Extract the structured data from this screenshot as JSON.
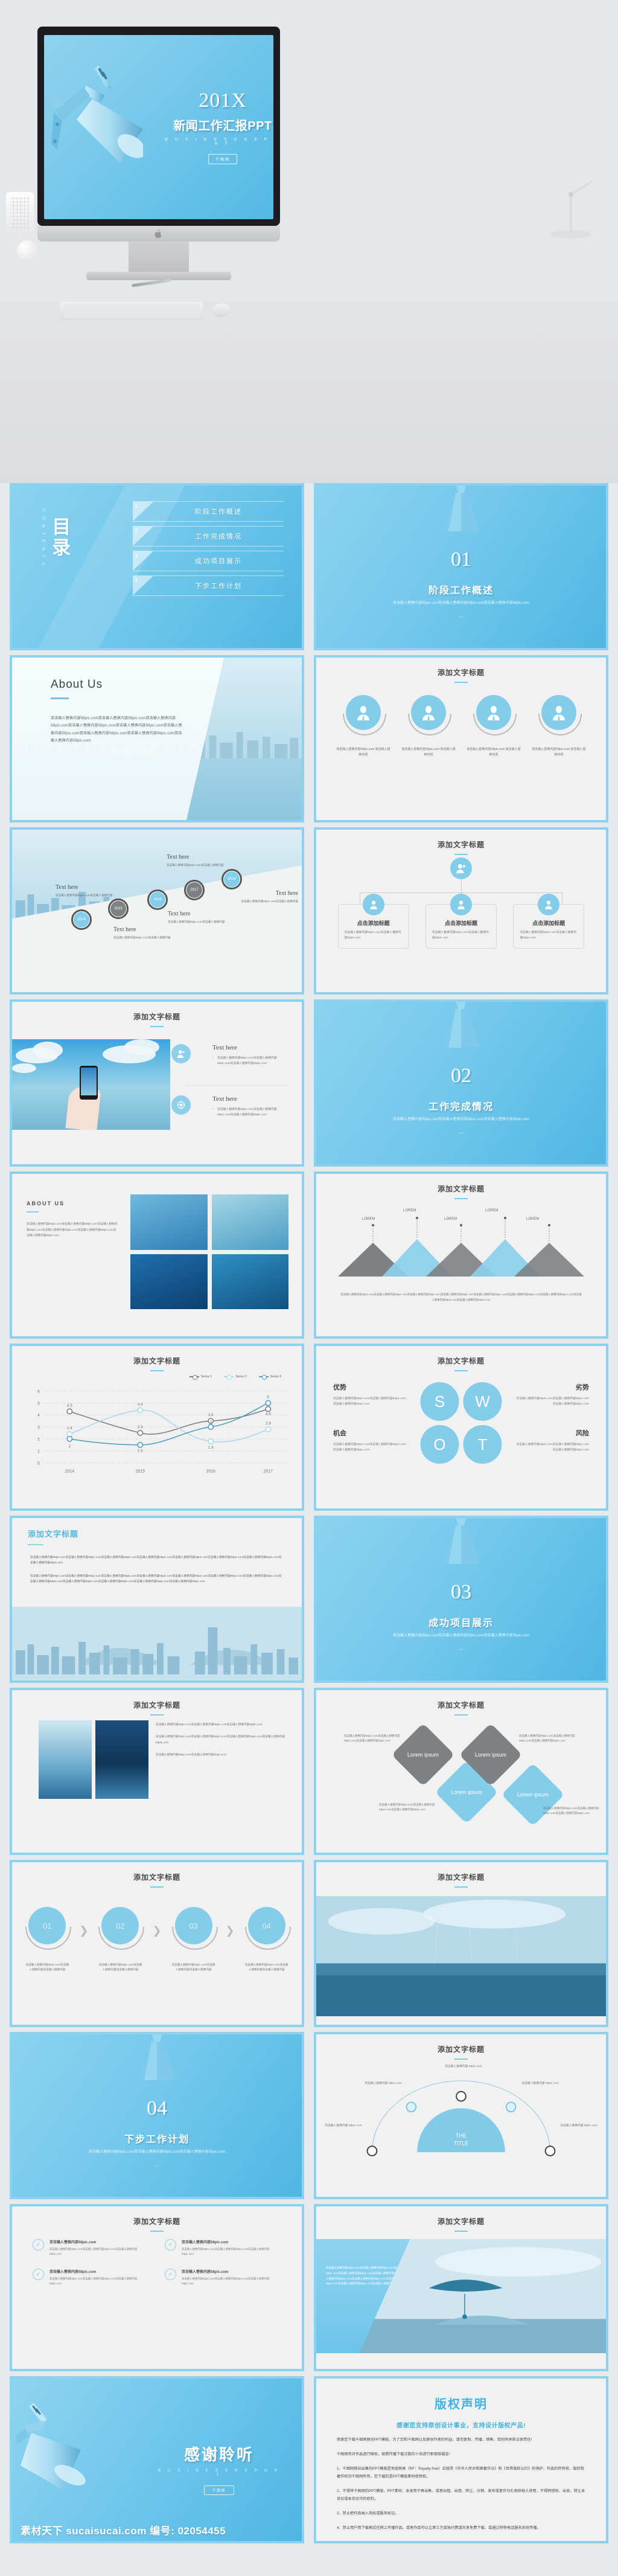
{
  "cover": {
    "year": "201X",
    "title": "新闻工作汇报PPT",
    "subtitle": "B U S I N E S S   R E P O R T",
    "badge": "千图网"
  },
  "toc": {
    "heading_cn": "目录",
    "heading_en": "C O N T E N T S",
    "items": [
      {
        "num": "1",
        "label": "阶段工作概述"
      },
      {
        "num": "2",
        "label": "工作完成情况"
      },
      {
        "num": "3",
        "label": "成功项目展示"
      },
      {
        "num": "4",
        "label": "下步工作计划"
      }
    ]
  },
  "sections": [
    {
      "num": "01",
      "cn": "阶段工作概述",
      "desc": "双击输入替换内容58pic.com双击输入替换内容58pic.com双击输入替换内容58pic.com",
      "dash": "—"
    },
    {
      "num": "02",
      "cn": "工作完成情况",
      "desc": "双击输入替换内容58pic.com双击输入替换内容58pic.com双击输入替换内容58pic.com",
      "dash": "—"
    },
    {
      "num": "03",
      "cn": "成功项目展示",
      "desc": "双击输入替换内容58pic.com双击输入替换内容58pic.com双击输入替换内容58pic.com",
      "dash": "—"
    },
    {
      "num": "04",
      "cn": "下步工作计划",
      "desc": "双击输入替换内容58pic.com双击输入替换内容58pic.com双击输入替换内容58pic.com",
      "dash": "—"
    }
  ],
  "common": {
    "slide_title": "添加文字标题",
    "placeholder_para": "双击输入替换内容58pic.com双击输入替换内容58pic.com双击输入替换内容58pic.com双击输入替换内容58pic.com双击输入替换内容58pic.com双击输入替换内容58pic.com双击输入替换内容58pic.com",
    "placeholder_short": "双击输入替换内容58pic.com双击输入替换内容",
    "placeholder_mid": "双击输入替换内容58pic.com双击输入替换内容58pic.com"
  },
  "about": {
    "title": "About Us",
    "body": "双击输入替换内容58pic.com双击输入替换内容58pic.com双击输入替换内容58pic.com双击输入替换内容58pic.com双击输入替换内容58pic.com双击输入替换内容58pic.com双击输入替换内容58pic.com双击输入替换内容58pic.com双击输入替换内容58pic.com"
  },
  "avatars": {
    "caption": "双击输入替换内容58pic.com 双击输入替换内容",
    "items": [
      "user-icon",
      "user-icon",
      "user-icon",
      "user-icon"
    ]
  },
  "timeline": {
    "nodes": [
      {
        "year": "2014",
        "style": "blue",
        "heading": "Text here",
        "body": "双击输入替换内容58pic.com双击输入替换内容"
      },
      {
        "year": "2015",
        "style": "gray",
        "heading": "Text here",
        "body": "双击输入替换内容58pic.com双击输入替换内容"
      },
      {
        "year": "2016",
        "style": "blue",
        "heading": "Text here",
        "body": "双击输入替换内容58pic.com双击输入替换内容"
      },
      {
        "year": "2017",
        "style": "gray",
        "heading": "Text here",
        "body": "双击输入替换内容58pic.com双击输入替换内容"
      },
      {
        "year": "2018",
        "style": "blue",
        "heading": "Text here",
        "body": "双击输入替换内容58pic.com双击输入替换内容"
      }
    ]
  },
  "org": {
    "cards": [
      {
        "title": "点击添加标题",
        "body": "双击输入替换内容58pic.com双击输入替换内容58pic.com"
      },
      {
        "title": "点击添加标题",
        "body": "双击输入替换内容58pic.com双击输入替换内容58pic.com"
      },
      {
        "title": "点击添加标题",
        "body": "双击输入替换内容58pic.com双击输入替换内容58pic.com"
      }
    ]
  },
  "phone": {
    "rows": [
      {
        "heading": "Text here",
        "bullet": "双击输入替换内容58pic.com双击输入替换内容58pic.com双击输入替换内容58pic.com",
        "icon": "add-user-icon"
      },
      {
        "heading": "Text here",
        "bullet": "双击输入替换内容58pic.com双击输入替换内容58pic.com双击输入替换内容58pic.com",
        "icon": "target-icon"
      }
    ]
  },
  "about_gallery": {
    "heading": "ABOUT US",
    "body": "双击输入替换内容58pic.com双击输入替换内容58pic.com双击输入替换内容58pic.com双击输入替换内容58pic.com双击输入替换内容58pic.com双击输入替换内容58pic.com"
  },
  "city_text": {
    "p1": "双击输入替换内容58pic.com双击输入替换内容58pic.com双击输入替换内容58pic.com双击输入替换内容58pic.com双击输入替换内容58pic.com双击输入替换内容58pic.com双击输入替换内容58pic.com双击输入替换内容58pic.com",
    "p2": "双击输入替换内容58pic.com双击输入替换内容58pic.com双击输入替换内容58pic.com双击输入替换内容58pic.com双击输入替换内容58pic.com双击输入替换内容58pic.com双击输入替换内容58pic.com双击输入替换内容58pic.com双击输入替换内容58pic.com双击输入替换内容58pic.com双击输入替换内容58pic.com双击输入替换内容58pic.com"
  },
  "two_photo": {
    "p1": "双击输入替换内容58pic.com双击输入替换内容58pic.com双击输入替换内容58pic.com",
    "p2": "双击输入替换内容58pic.com双击输入替换内容58pic.com双击输入替换内容58pic.com双击输入替换内容58pic.com",
    "p3": "双击输入替换内容58pic.com双击输入替换内容58pic.com"
  },
  "diamonds": {
    "items": [
      {
        "label": "Lorem ipsum",
        "style": "gray",
        "note": "双击输入替换内容58pic.com双击输入替换内容58pic.com双击输入替换内容58pic.com"
      },
      {
        "label": "Lorem ipsum",
        "style": "blue",
        "note": "双击输入替换内容58pic.com双击输入替换内容58pic.com双击输入替换内容58pic.com"
      },
      {
        "label": "Lorem ipsum",
        "style": "gray",
        "note": "双击输入替换内容58pic.com双击输入替换内容58pic.com双击输入替换内容58pic.com"
      },
      {
        "label": "Lorem ipsum",
        "style": "blue",
        "note": "双击输入替换内容58pic.com双击输入替换内容58pic.com双击输入替换内容58pic.com"
      }
    ]
  },
  "process": {
    "steps": [
      {
        "num": "01",
        "caption": "双击输入替换内容58pic.com双击输入替换内容双击输入替换内容"
      },
      {
        "num": "02",
        "caption": "双击输入替换内容58pic.com双击输入替换内容双击输入替换内容"
      },
      {
        "num": "03",
        "caption": "双击输入替换内容58pic.com双击输入替换内容双击输入替换内容"
      },
      {
        "num": "04",
        "caption": "双击输入替换内容58pic.com双击输入替换内容双击输入替换内容"
      }
    ],
    "arrow": "❯"
  },
  "arc": {
    "center": "THE TITLE",
    "labels": [
      "双击输入替换内容 58pic.com",
      "双击输入替换内容 58pic.com",
      "双击输入替换内容 58pic.com",
      "双击输入替换内容 58pic.com",
      "双击输入替换内容 58pic.com"
    ]
  },
  "checklist": {
    "items": [
      {
        "icon": "check-icon",
        "title": "双击输入替换内容58pic.com",
        "body": "双击输入替换内容58pic.com双击输入替换内容58pic.com双击输入替换内容58pic.com"
      },
      {
        "icon": "check-icon",
        "title": "双击输入替换内容58pic.com",
        "body": "双击输入替换内容58pic.com双击输入替换内容58pic.com双击输入替换内容58pic.com"
      },
      {
        "icon": "check-icon",
        "title": "双击输入替换内容58pic.com",
        "body": "双击输入替换内容58pic.com双击输入替换内容58pic.com双击输入替换内容58pic.com"
      },
      {
        "icon": "check-icon",
        "title": "双击输入替换内容58pic.com",
        "body": "双击输入替换内容58pic.com双击输入替换内容58pic.com双击输入替换内容58pic.com"
      }
    ]
  },
  "paraglide": {
    "body": "双击输入替换内容58pic.com双击输入替换内容58pic.com双击输入替换内容58pic.com双击输入替换内容58pic.com双击输入替换内容58pic.com双击输入替换内容58pic.com双击输入替换内容58pic.com双击输入替换内容58pic.com双击输入替换内容58pic.com双击输入替换内容58pic.com"
  },
  "thanks": {
    "title": "感谢聆听",
    "subtitle": "B U S I N E S S   R E P O R T",
    "badge": "千图网"
  },
  "copyright": {
    "title": "版权声明",
    "lead": "感谢您支持原创设计事业，支持设计版权产品!",
    "p1": "感谢您下载千图网原创PPT模板，为了您和千图网以及原创作者的利益，请勿复制、传播、销售，否则将承担法律责任!",
    "p2": "千图网将对作品进行维权，按照传播下载次数的十倍进行索取赔偿金!",
    "p3": "1、千图网网站出售的PPT模版是免版税类（RF：Royalty-free）正版受《中华人民共和国著作法》和《世界版权公约》的保护，作品的所有权、版权和著作权归千图网所有，您下载的是PPT模版素材使用权。",
    "p4": "2、不得将千图网的PPT模版、PPT素材，本身用于再出售，或者出租、出借、转让、分销、发布或者作为礼物供他人使用，不得转授权、出卖、转让本协议或本协议中的权利。",
    "p5": "3、禁止把作品纳入商标或服务标记。",
    "p6": "4、禁止用户用下载格式在网上传播作品。或者作品可以让第三方单独付费或共享免费下载、或通过转移电话服务系统传播。"
  },
  "watermark": "素材天下 sucaisucai.com 编号: 02054455",
  "chart_data": [
    {
      "type": "line",
      "title": "添加文字标题",
      "x": [
        "2014",
        "2015",
        "2016",
        "2017"
      ],
      "series": [
        {
          "name": "Series 1",
          "values": [
            4.3,
            2.5,
            3.5,
            4.5
          ],
          "color": "#7b7f83"
        },
        {
          "name": "Series 2",
          "values": [
            2.4,
            4.4,
            1.8,
            2.8
          ],
          "color": "#a9d8ec"
        },
        {
          "name": "Series 3",
          "values": [
            2,
            1.5,
            3,
            5
          ],
          "color": "#4f9fc0"
        }
      ],
      "ylim": [
        0,
        6
      ],
      "yticks": [
        0,
        1,
        2,
        3,
        4,
        5,
        6
      ],
      "xlabel": "",
      "ylabel": "",
      "grid": true,
      "legend_position": "top-right"
    },
    {
      "type": "bar",
      "title": "添加文字标题",
      "categories": [
        "LOREM",
        "LOREM",
        "LOREM",
        "LOREM",
        "LOREM"
      ],
      "values": [
        1,
        1.25,
        1,
        1.25,
        1
      ],
      "colors": [
        "#7e8184",
        "#8ad0ea",
        "#7e8184",
        "#8ad0ea",
        "#7e8184"
      ],
      "note": "双击输入替换内容58pic.com双击输入替换内容58pic.com双击输入替换内容58pic.com双击输入替换内容58pic.com双击输入替换内容58pic.com双击输入替换内容58pic.com双击输入替换内容58pic.com双击输入替换内容58pic.com双击输入替换内容58pic.com"
    }
  ],
  "swot": {
    "title": "添加文字标题",
    "letters": [
      "S",
      "W",
      "O",
      "T"
    ],
    "quadrants": [
      {
        "heading": "优势",
        "body": "双击输入替换内容58pic.com双击输入替换内容58pic.com双击输入替换内容58pic.com"
      },
      {
        "heading": "劣势",
        "body": "双击输入替换内容58pic.com双击输入替换内容58pic.com双击输入替换内容58pic.com"
      },
      {
        "heading": "机会",
        "body": "双击输入替换内容58pic.com双击输入替换内容58pic.com双击输入替换内容58pic.com"
      },
      {
        "heading": "风险",
        "body": "双击输入替换内容58pic.com双击输入替换内容58pic.com双击输入替换内容58pic.com"
      }
    ]
  }
}
